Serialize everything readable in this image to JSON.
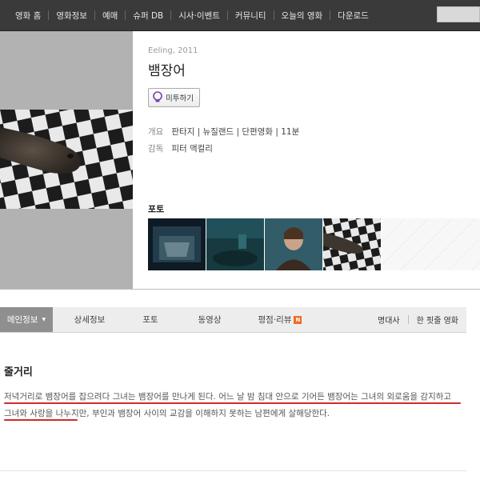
{
  "nav": {
    "items": [
      "영화 홈",
      "영화정보",
      "예매",
      "슈퍼 DB",
      "시사·이벤트",
      "커뮤니티",
      "오늘의 영화",
      "다운로드"
    ]
  },
  "movie": {
    "original_title": "Eeling, 2011",
    "title": "뱀장어",
    "wish_button": "미투하기",
    "summary_label": "개요",
    "summary_value": "판타지 | 뉴질랜드 | 단편영화 | 11분",
    "director_label": "감독",
    "director_value": "피터 맥컬리"
  },
  "photos": {
    "heading": "포토"
  },
  "tabs": {
    "items": [
      "메인정보",
      "상세정보",
      "포토",
      "동영상",
      "평점·리뷰"
    ],
    "active_index": 0,
    "new_badge": "N",
    "right_items": [
      "명대사",
      "한 핏줄 영화"
    ]
  },
  "synopsis": {
    "heading": "줄거리",
    "text": "저녁거리로 뱀장어를 잡으려다 그녀는 뱀장어를 만나게 된다. 어느 날 밤 침대 안으로 기어든 뱀장어는 그녀의 외로움을 감지하고 그녀와 사랑을 나누지만, 부인과 뱀장어 사이의 교감을 이해하지 못하는 남편에게 살해당한다."
  },
  "colors": {
    "nav_bg": "#3a3a3a",
    "active_tab": "#8f8f8f",
    "badge": "#f26a21",
    "highlight": "#d12b2b",
    "wish_icon": "#7b3fa6"
  }
}
